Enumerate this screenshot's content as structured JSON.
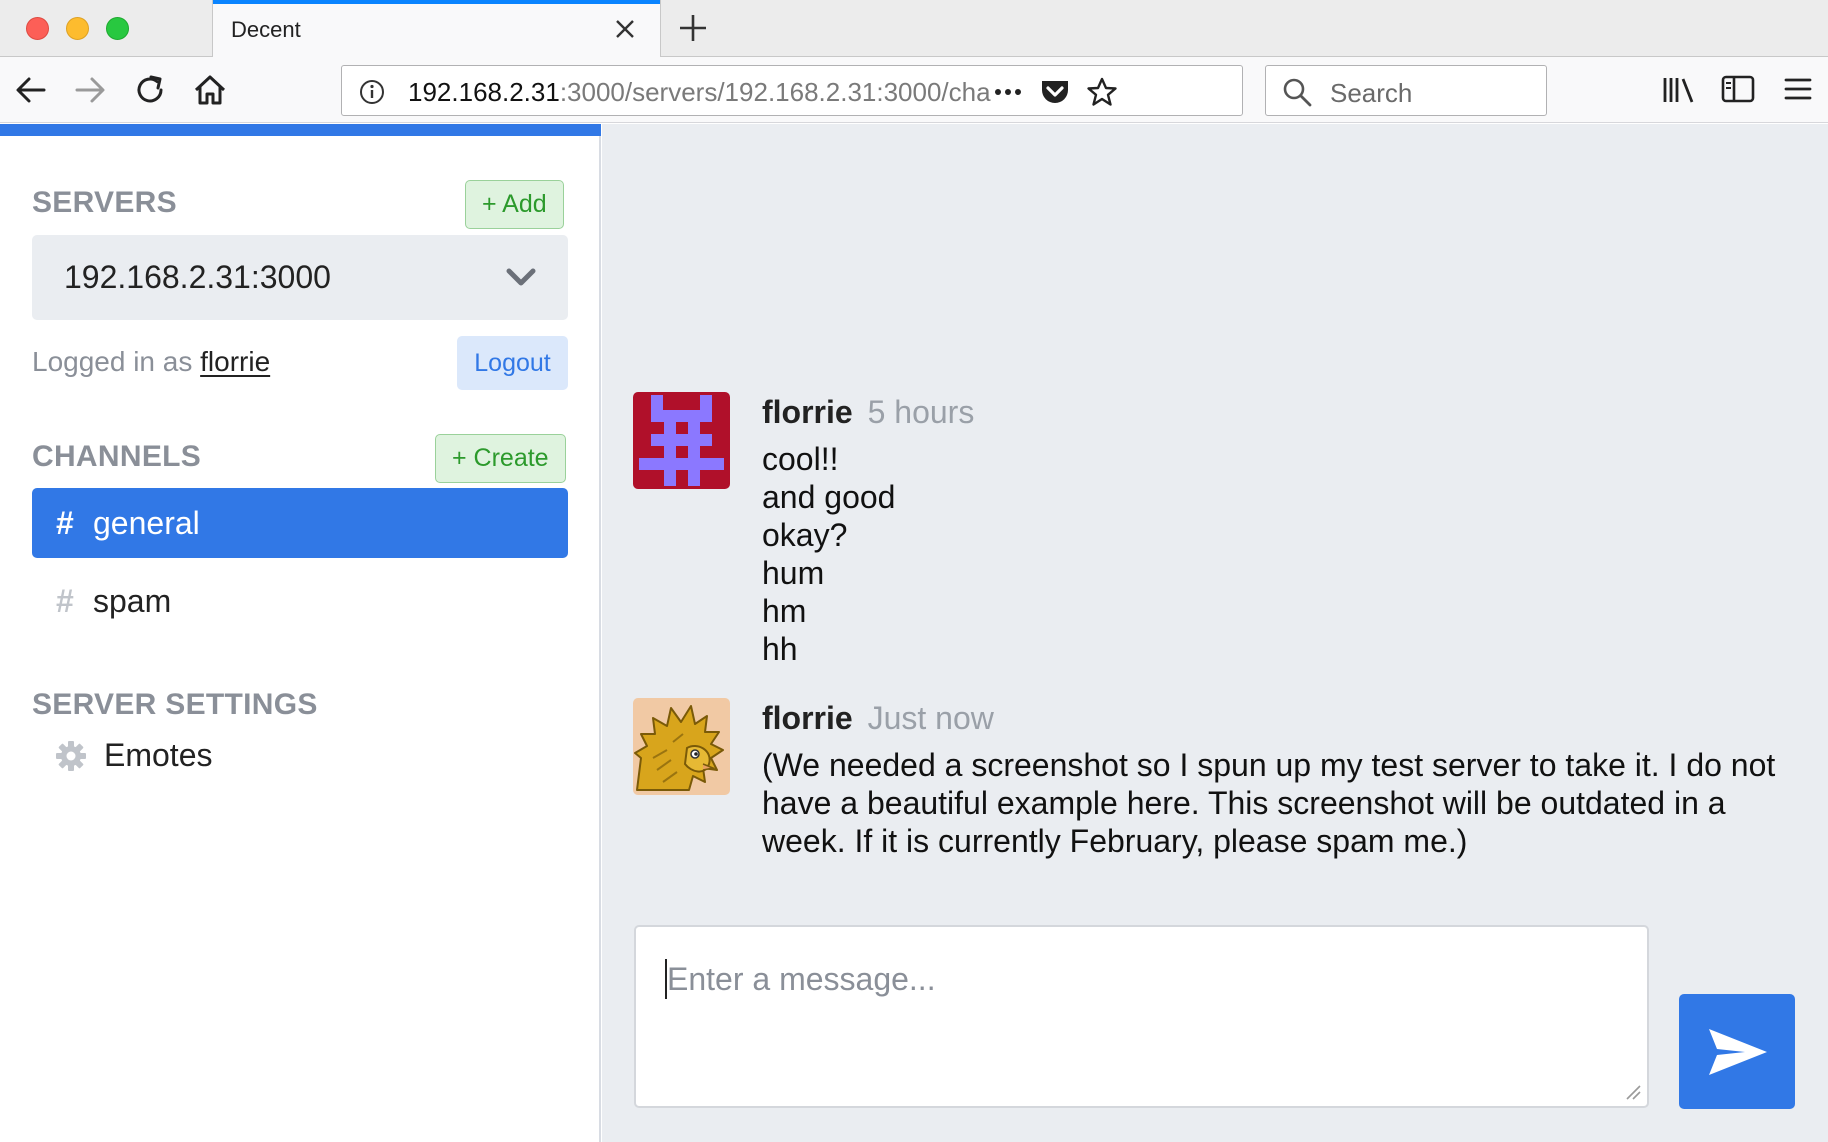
{
  "browser": {
    "tab_title": "Decent",
    "url_host": "192.168.2.31",
    "url_rest": ":3000/servers/192.168.2.31:3000/cha",
    "search_placeholder": "Search",
    "icons": {
      "back": "back-arrow-icon",
      "forward": "forward-arrow-icon",
      "reload": "reload-icon",
      "home": "home-icon",
      "info": "info-icon",
      "more": "more-dots-icon",
      "pocket": "pocket-icon",
      "bookmark": "star-icon",
      "search": "search-icon",
      "library": "library-icon",
      "sidebar": "sidebar-icon",
      "menu": "hamburger-menu-icon"
    }
  },
  "sidebar": {
    "servers_heading": "SERVERS",
    "add_label": "+ Add",
    "selected_server": "192.168.2.31:3000",
    "logged_in_prefix": "Logged in as",
    "logged_in_user": "florrie",
    "logout_label": "Logout",
    "channels_heading": "CHANNELS",
    "create_label": "+ Create",
    "channels": [
      {
        "hash": "#",
        "name": "general",
        "active": true
      },
      {
        "hash": "#",
        "name": "spam",
        "active": false
      }
    ],
    "settings_heading": "SERVER SETTINGS",
    "settings_items": [
      {
        "icon": "gear-icon",
        "label": "Emotes"
      }
    ]
  },
  "messages": [
    {
      "author": "florrie",
      "time": "5 hours",
      "avatar": "pixel-identicon-avatar",
      "lines": [
        "cool!!",
        "and good",
        "okay?",
        "hum",
        "hm",
        "hh"
      ]
    },
    {
      "author": "florrie",
      "time": "Just now",
      "avatar": "porcupine-drawing-avatar",
      "lines": [
        "(We needed a screenshot so I spun up my test server to take it. I do not have a beautiful example here. This screenshot will be outdated in a week. If it is currently February, please spam me.)"
      ]
    }
  ],
  "composer": {
    "placeholder": "Enter a message...",
    "send_icon": "send-paper-plane-icon"
  },
  "colors": {
    "accent": "#3178e6",
    "success": "#2c9a2c",
    "muted": "#8a8f98",
    "avatar_red": "#b0102a",
    "avatar_purple": "#8b78ff"
  }
}
